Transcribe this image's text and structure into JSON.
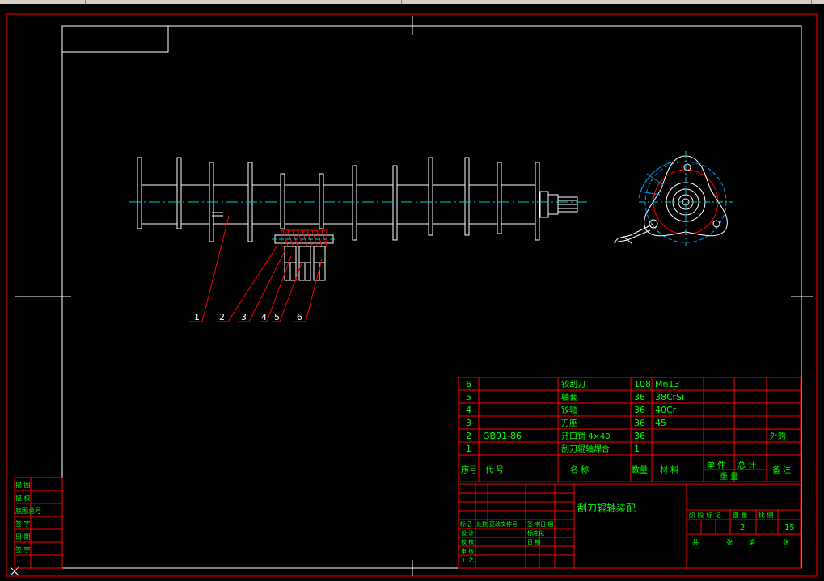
{
  "drawing": {
    "title": "刮刀辊轴装配",
    "scale_label": "2",
    "sheet_count": "15",
    "balloons": [
      "1",
      "2",
      "3",
      "4",
      "5",
      "6"
    ]
  },
  "bom": {
    "rows": [
      {
        "seq": "6",
        "code": "",
        "name": "铰刮刀",
        "qty": "108",
        "material": "Mn13",
        "note": ""
      },
      {
        "seq": "5",
        "code": "",
        "name": "轴套",
        "qty": "36",
        "material": "38CrSi",
        "note": ""
      },
      {
        "seq": "4",
        "code": "",
        "name": "铰轴",
        "qty": "36",
        "material": "40Cr",
        "note": ""
      },
      {
        "seq": "3",
        "code": "",
        "name": "刀座",
        "qty": "36",
        "material": "45",
        "note": ""
      },
      {
        "seq": "2",
        "code": "GB91-86",
        "name": "开口销 4×40",
        "qty": "36",
        "material": "",
        "note": "外购"
      },
      {
        "seq": "1",
        "code": "",
        "name": "刮刀辊轴焊合",
        "qty": "1",
        "material": "",
        "note": ""
      }
    ],
    "header": {
      "seq": "序号",
      "code": "代 号",
      "name": "名 称",
      "qty": "数量",
      "material": "材 料",
      "unit_weight": "单 件",
      "total_weight": "总 计",
      "weight": "重 量",
      "note": "备 注"
    }
  },
  "titleblock": {
    "rev_labels": [
      "标记",
      "处数",
      "更改文件号",
      "签 字",
      "日 期"
    ],
    "left_labels": [
      "设 计",
      "标准化",
      "校 核",
      "审 核",
      "工 艺",
      "日 期"
    ],
    "right_header": [
      "阶 段 标 记",
      "重 量",
      "比 例"
    ],
    "bottom": [
      "共",
      "张",
      "第",
      "张"
    ]
  },
  "side_block": {
    "labels": [
      "描 图",
      "描 校",
      "底图总号",
      "签 字",
      "日 期",
      "签 字"
    ]
  },
  "colors": {
    "background": "#000000",
    "frame": "#ffffff",
    "outer_border": "#ff0000",
    "centerline": "#00c8c8",
    "leaders": "#ff0000",
    "table_lines": "#ff0000",
    "table_text": "#00ff00",
    "hatch": "#ff0000",
    "accent_circle": "#00a0ff"
  }
}
